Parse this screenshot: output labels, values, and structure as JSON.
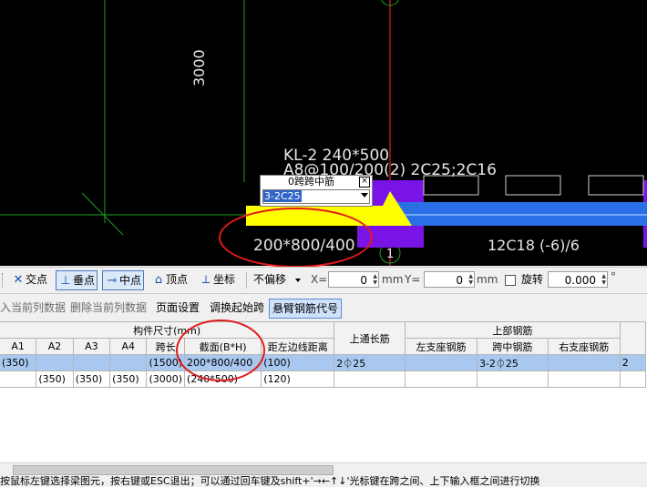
{
  "canvas": {
    "dim_label": "3000",
    "beam_label_line1": "KL-2 240*500",
    "beam_label_line2": "A8@100/200(2) 2C25;2C16",
    "section_label": "200*800/400",
    "right_label": "12C18 (-6)/6",
    "axis_label": "1",
    "popup": {
      "title": "0跨跨中筋",
      "close": "×",
      "value": "3-2C25"
    }
  },
  "snap_toolbar": {
    "items": [
      {
        "icon": "cross-icon",
        "glyph": "✕",
        "label": "交点"
      },
      {
        "icon": "perpendicular-icon",
        "glyph": "⊥",
        "label": "垂点"
      },
      {
        "icon": "midpoint-icon",
        "glyph": "⊸",
        "label": "中点"
      },
      {
        "icon": "vertex-icon",
        "glyph": "⌂",
        "label": "顶点"
      },
      {
        "icon": "coordinate-icon",
        "glyph": "⟂",
        "label": "坐标"
      }
    ],
    "offset_mode": "不偏移",
    "x_label": "X=",
    "x_value": "0",
    "x_unit": "mm",
    "y_label": "Y=",
    "y_value": "0",
    "y_unit": "mm",
    "rotate_label": "旋转",
    "rotate_value": "0.000",
    "degree": "°"
  },
  "action_toolbar": {
    "items": [
      "入当前列数据",
      "删除当前列数据",
      "页面设置",
      "调换起始跨",
      "悬臂钢筋代号"
    ]
  },
  "grid": {
    "group_size": "构件尺寸(mm)",
    "group_top_long": "上通长筋",
    "group_top_bar": "上部钢筋",
    "cols": [
      "A1",
      "A2",
      "A3",
      "A4",
      "跨长",
      "截面(B*H)",
      "距左边线距离"
    ],
    "top_bar_cols": [
      "左支座钢筋",
      "跨中钢筋",
      "右支座钢筋"
    ],
    "rows": [
      {
        "a1": "(350)",
        "a2": "",
        "a3": "",
        "a4": "",
        "span": "(1500)",
        "section": "200*800/400",
        "dist": "(100)",
        "top_long": "2⏀25",
        "left": "",
        "mid": "3-2⏀25",
        "right": "",
        "extra": "2"
      },
      {
        "a1": "",
        "a2": "(350)",
        "a3": "(350)",
        "a4": "(350)",
        "span": "(3000)",
        "section": "(240*500)",
        "dist": "(120)",
        "top_long": "",
        "left": "",
        "mid": "",
        "right": "",
        "extra": ""
      }
    ]
  },
  "status_text": "按鼠标左键选择梁图元，按右键或ESC退出；可以通过回车键及shift+'→←↑↓'光标键在跨之间、上下输入框之间进行切换"
}
